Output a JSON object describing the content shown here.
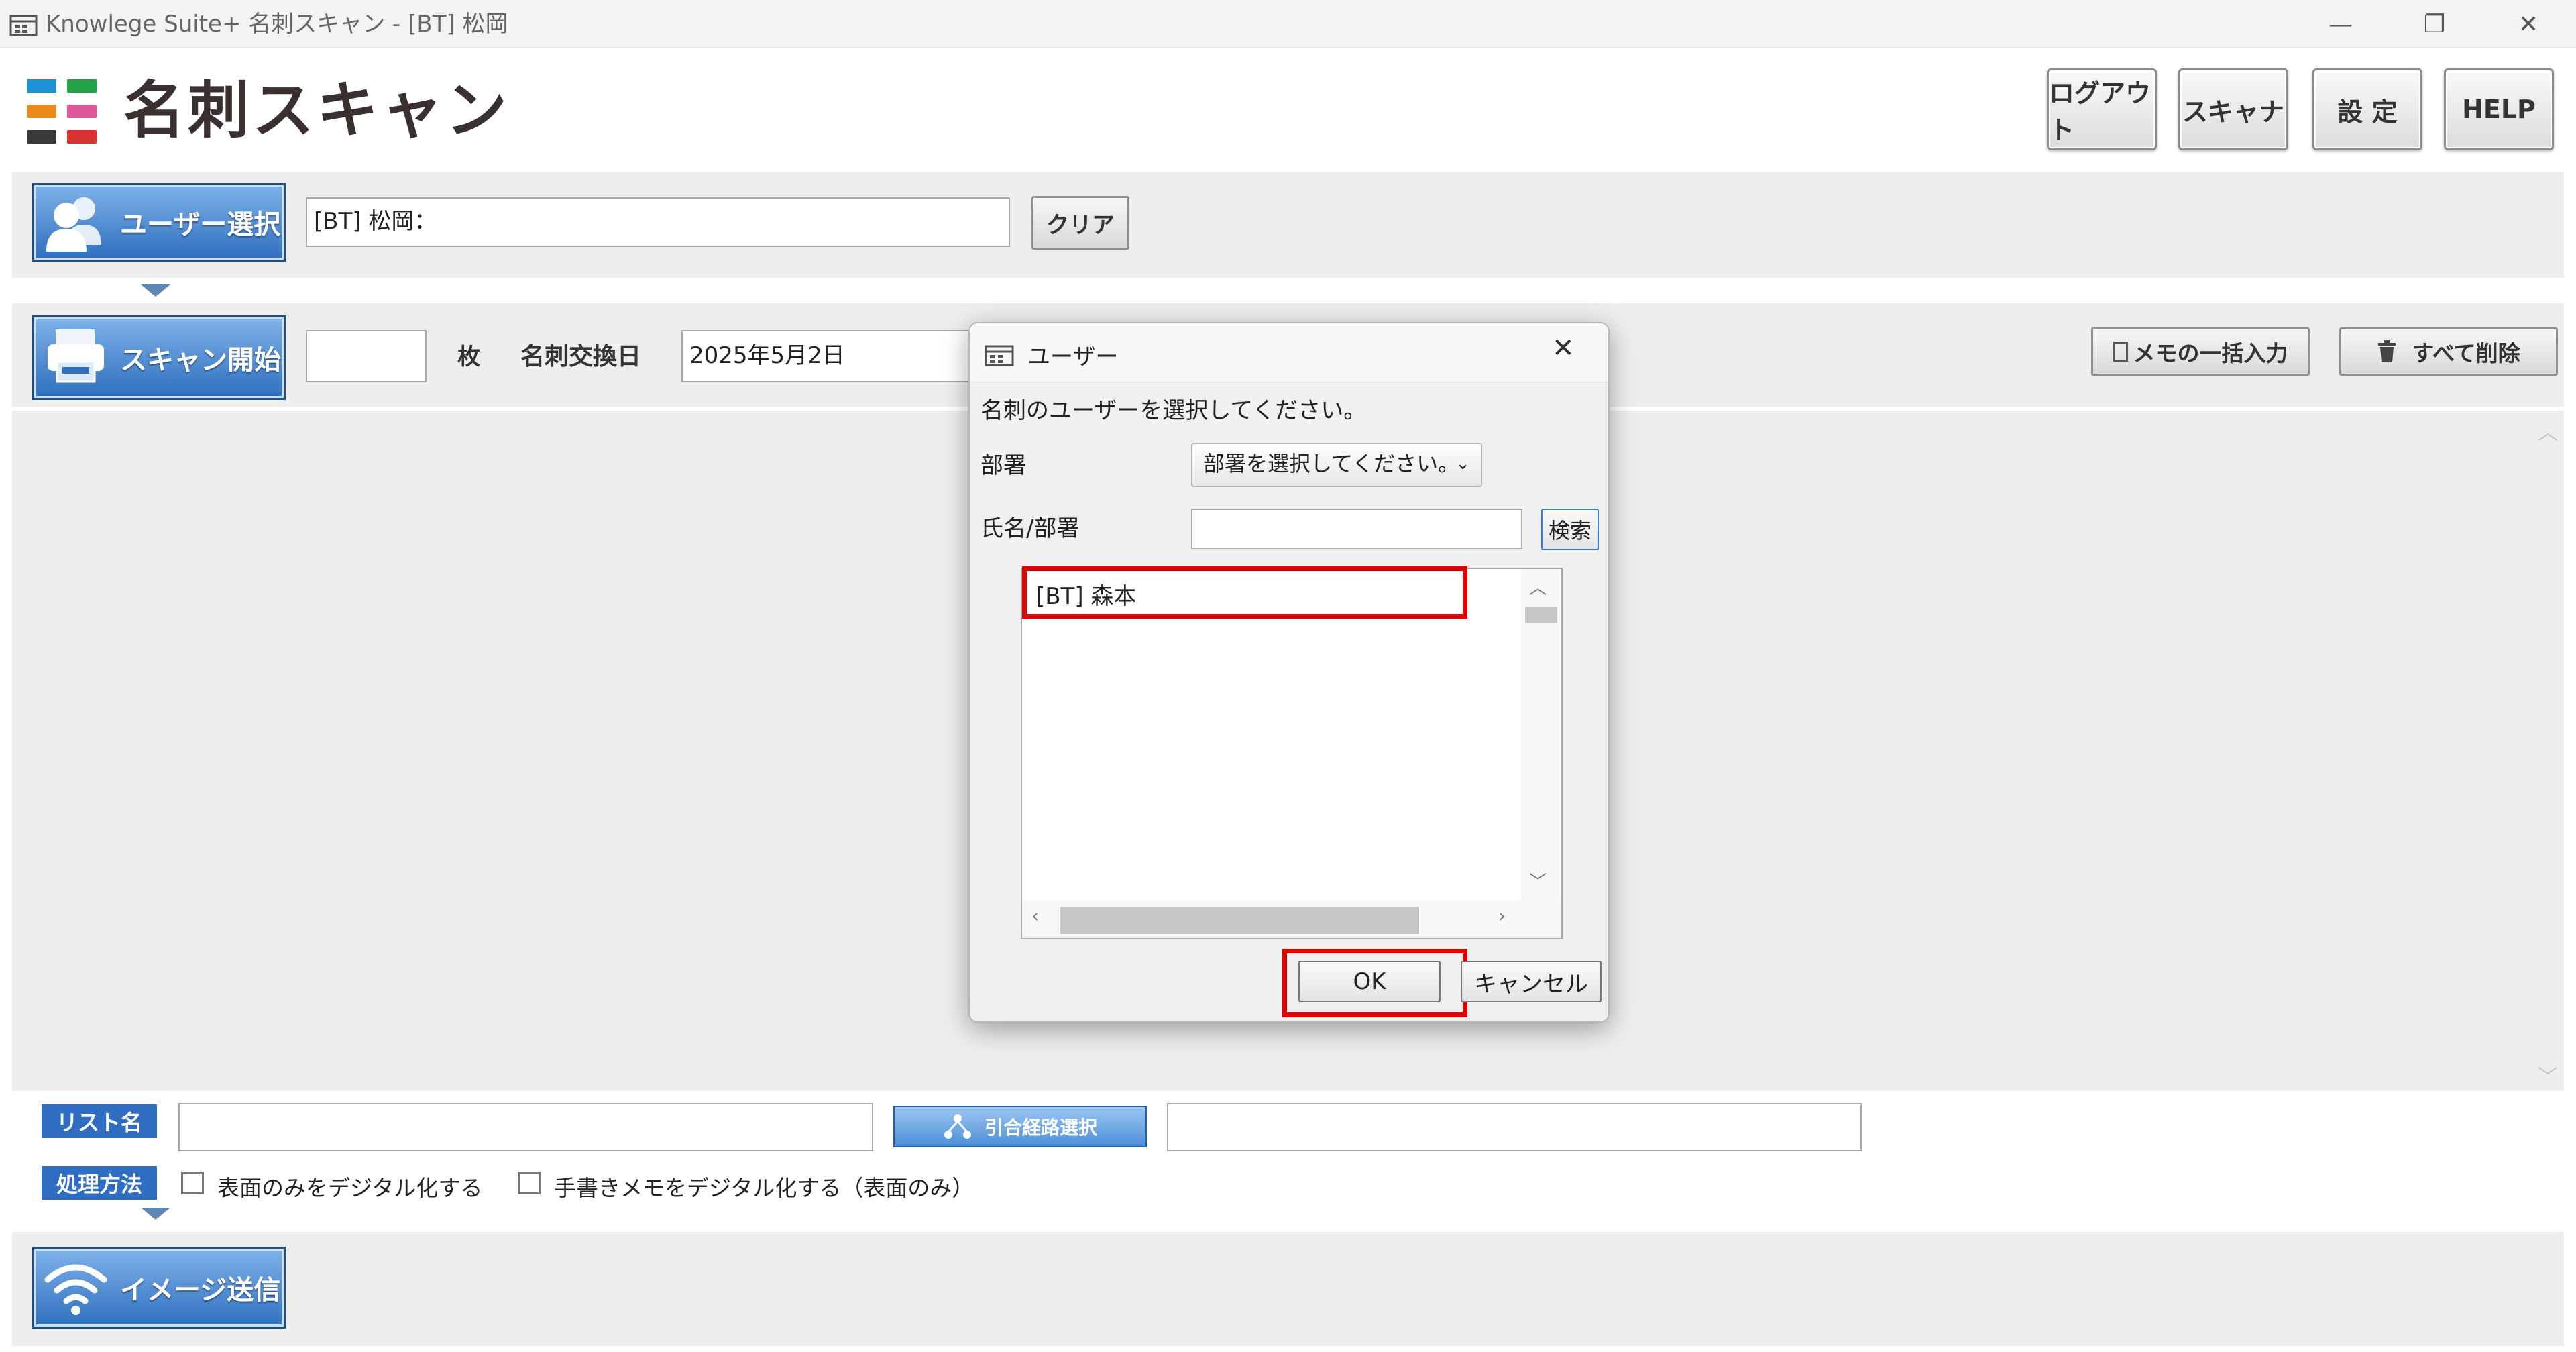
{
  "window": {
    "title": "Knowlege Suite+ 名刺スキャン - [BT] 松岡",
    "controls": {
      "minimize": "—",
      "restore": "❐",
      "close": "✕"
    }
  },
  "header": {
    "app_title": "名刺スキャン",
    "buttons": {
      "logout": "ログアウト",
      "scanner": "スキャナ",
      "settings": "設 定",
      "help": "HELP"
    },
    "logo_colors": [
      "#1f8fd6",
      "#25a04a",
      "#ec8a1c",
      "#e0589a",
      "#3a3a3a",
      "#d8332f"
    ]
  },
  "user_section": {
    "select_button": "ユーザー選択",
    "current_user": "[BT] 松岡：",
    "clear_button": "クリア"
  },
  "scan_section": {
    "start_button": "スキャン開始",
    "count_value": "",
    "count_unit": "枚",
    "exchange_date_label": "名刺交換日",
    "exchange_date_value": "2025年5月2日",
    "memo_bulk_button": "メモの一括入力",
    "delete_all_button": "すべて削除"
  },
  "bottom_section": {
    "list_name_label": "リスト名",
    "list_name_value": "",
    "route_button": "引合経路選択",
    "route_value": "",
    "method_label": "処理方法",
    "option_front_only": "表面のみをデジタル化する",
    "option_handwritten": "手書きメモをデジタル化する（表面のみ）",
    "send_button": "イメージ送信"
  },
  "dialog": {
    "title": "ユーザー",
    "instruction": "名刺のユーザーを選択してください。",
    "dept_label": "部署",
    "dept_select": "部署を選択してください。",
    "name_label": "氏名/部署",
    "name_value": "",
    "search_button": "検索",
    "users": [
      "[BT] 森本"
    ],
    "ok_button": "OK",
    "cancel_button": "キャンセル"
  },
  "colors": {
    "highlight": "#e00000",
    "accent_blue": "#2f6dc3"
  }
}
